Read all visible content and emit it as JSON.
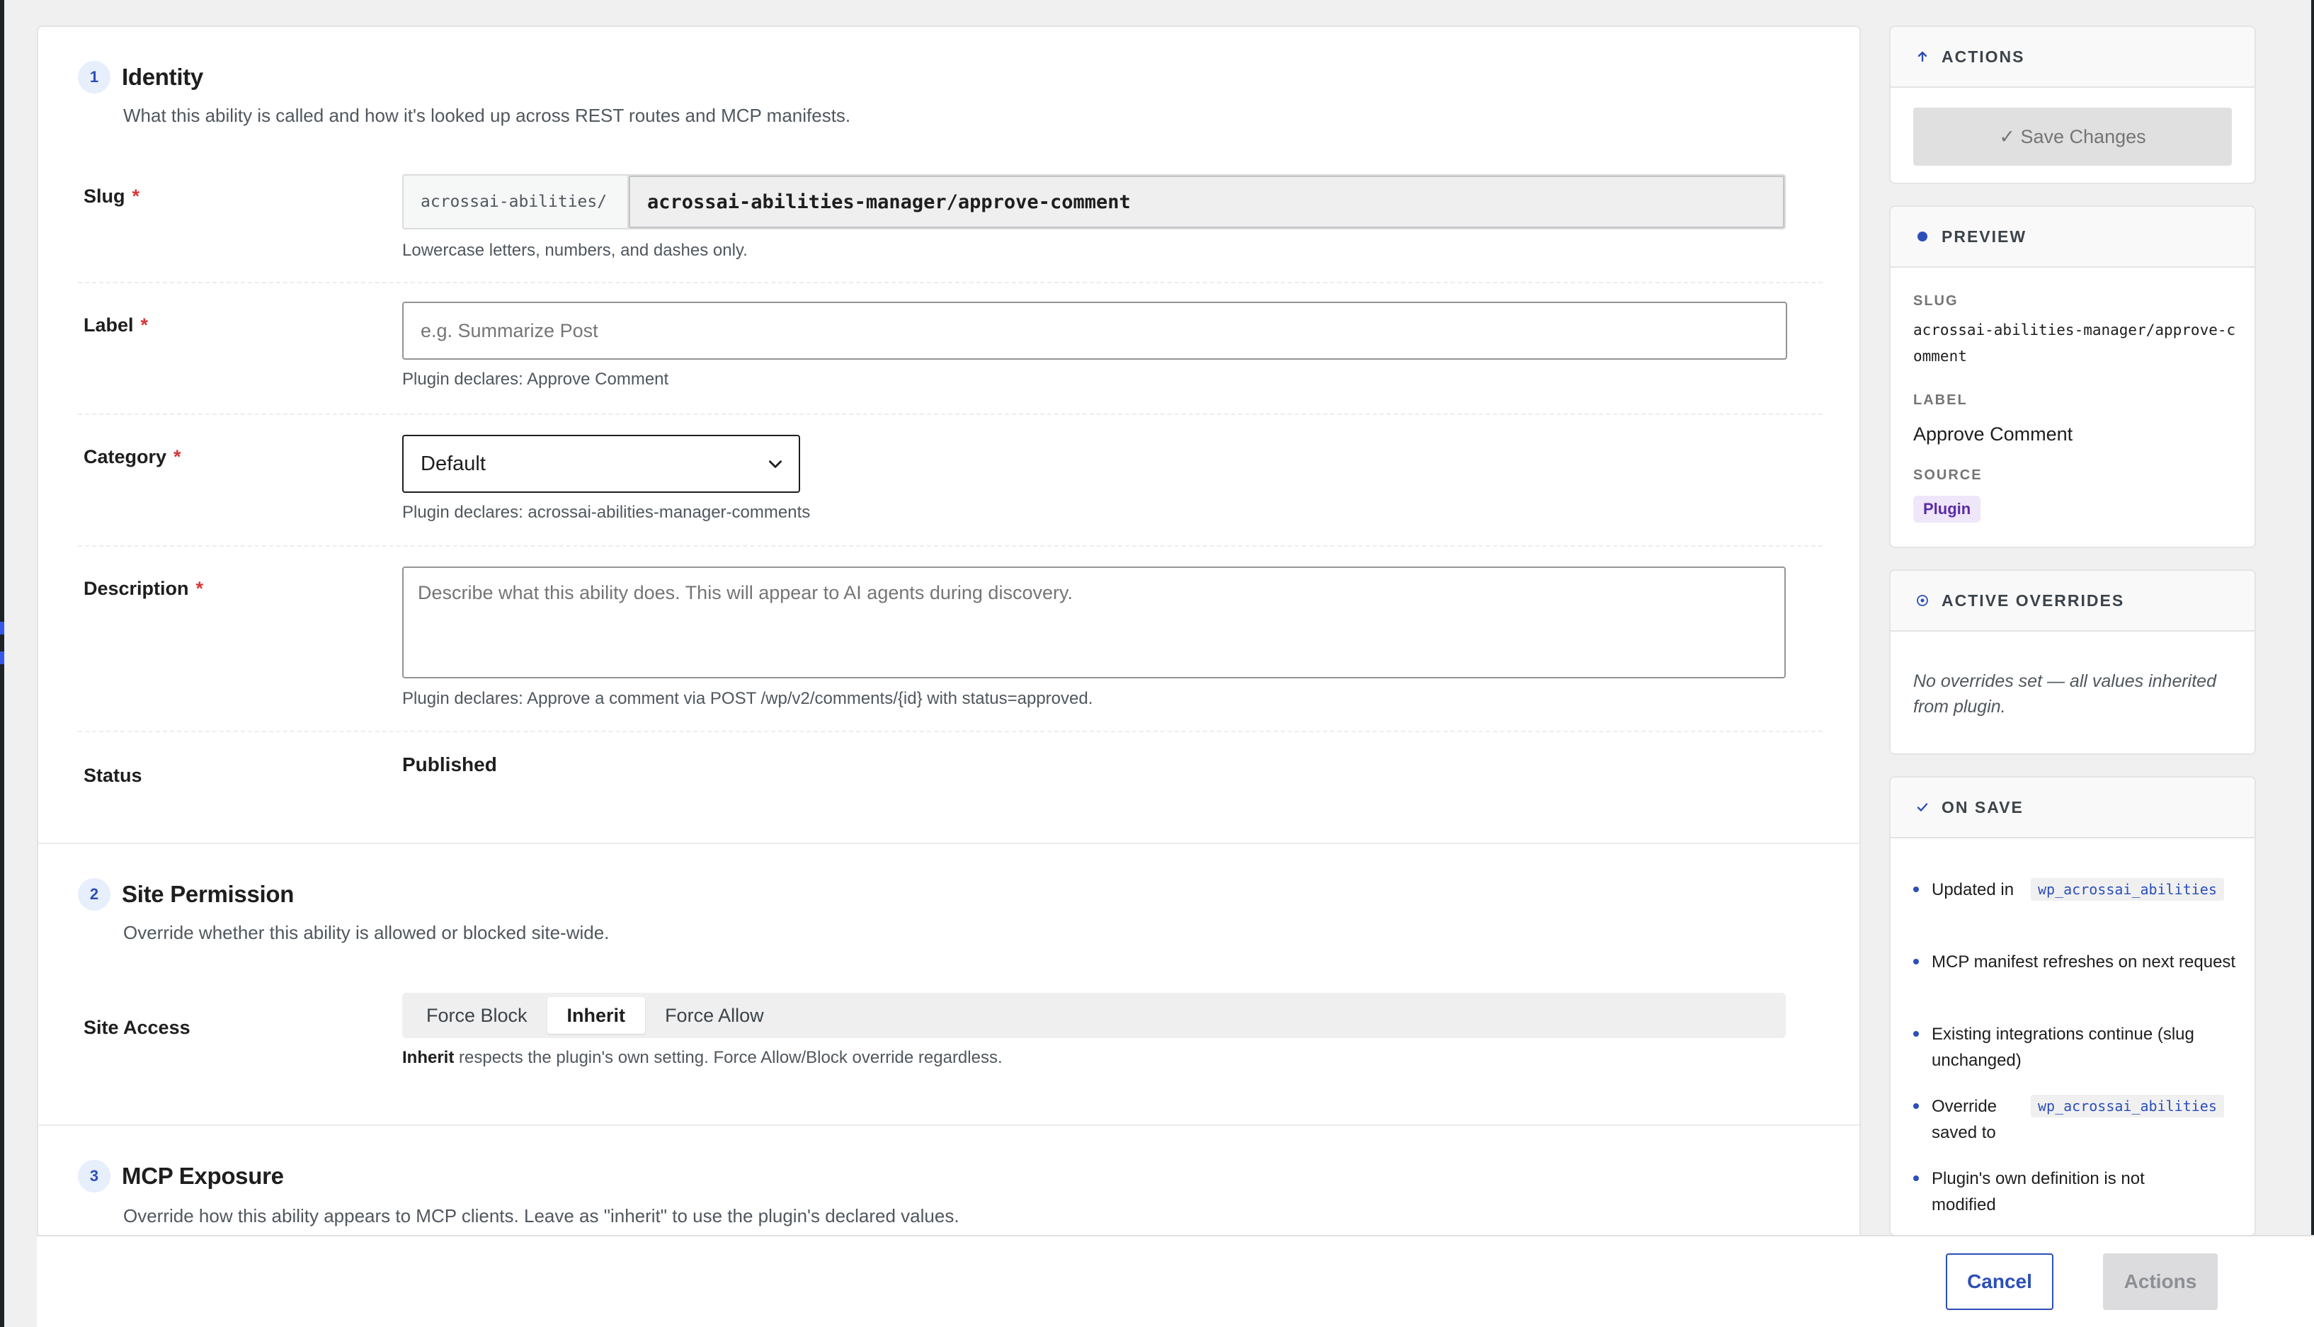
{
  "identity": {
    "number": "1",
    "title": "Identity",
    "subtitle": "What this ability is called and how it's looked up across REST routes and MCP manifests.",
    "slug": {
      "label": "Slug",
      "required": "*",
      "prefix": "acrossai-abilities/",
      "value": "acrossai-abilities-manager/approve-comment",
      "help": "Lowercase letters, numbers, and dashes only."
    },
    "label_field": {
      "label": "Label",
      "required": "*",
      "placeholder": "e.g. Summarize Post",
      "help": "Plugin declares: Approve Comment"
    },
    "category": {
      "label": "Category",
      "required": "*",
      "selected": "Default",
      "help": "Plugin declares: acrossai-abilities-manager-comments"
    },
    "description": {
      "label": "Description",
      "required": "*",
      "placeholder": "Describe what this ability does. This will appear to AI agents during discovery.",
      "help": "Plugin declares: Approve a comment via POST /wp/v2/comments/{id} with status=approved."
    },
    "status": {
      "label": "Status",
      "value": "Published"
    }
  },
  "site_permission": {
    "number": "2",
    "title": "Site Permission",
    "subtitle": "Override whether this ability is allowed or blocked site-wide.",
    "access_label": "Site Access",
    "options": [
      "Force Block",
      "Inherit",
      "Force Allow"
    ],
    "selected": "Inherit",
    "help_bold": "Inherit",
    "help_rest": " respects the plugin's own setting. Force Allow/Block override regardless."
  },
  "mcp": {
    "number": "3",
    "title": "MCP Exposure",
    "subtitle": "Override how this ability appears to MCP clients. Leave as \"inherit\" to use the plugin's declared values."
  },
  "footer": {
    "cancel": "Cancel",
    "actions": "Actions"
  },
  "sidebar": {
    "actions": {
      "title": "ACTIONS",
      "save": "✓ Save Changes"
    },
    "preview": {
      "title": "PREVIEW",
      "slug_label": "SLUG",
      "slug_value": "acrossai-abilities-manager/approve-comment",
      "label_label": "LABEL",
      "label_value": "Approve Comment",
      "source_label": "SOURCE",
      "source_value": "Plugin"
    },
    "overrides": {
      "title": "ACTIVE OVERRIDES",
      "text": "No overrides set — all values inherited from plugin."
    },
    "on_save": {
      "title": "ON SAVE",
      "items": [
        {
          "text": "Updated in",
          "code": "wp_acrossai_abilities"
        },
        {
          "text": "MCP manifest refreshes on next request"
        },
        {
          "text": "Existing integrations continue (slug unchanged)"
        },
        {
          "text": "Override saved to",
          "code": "wp_acrossai_abilities"
        },
        {
          "text": "Plugin's own definition is not modified"
        }
      ]
    }
  },
  "colors": {
    "accent": "#2c4fb8",
    "required": "#d63638",
    "badge_bg": "#efe6f9",
    "badge_fg": "#5b2ba6"
  }
}
